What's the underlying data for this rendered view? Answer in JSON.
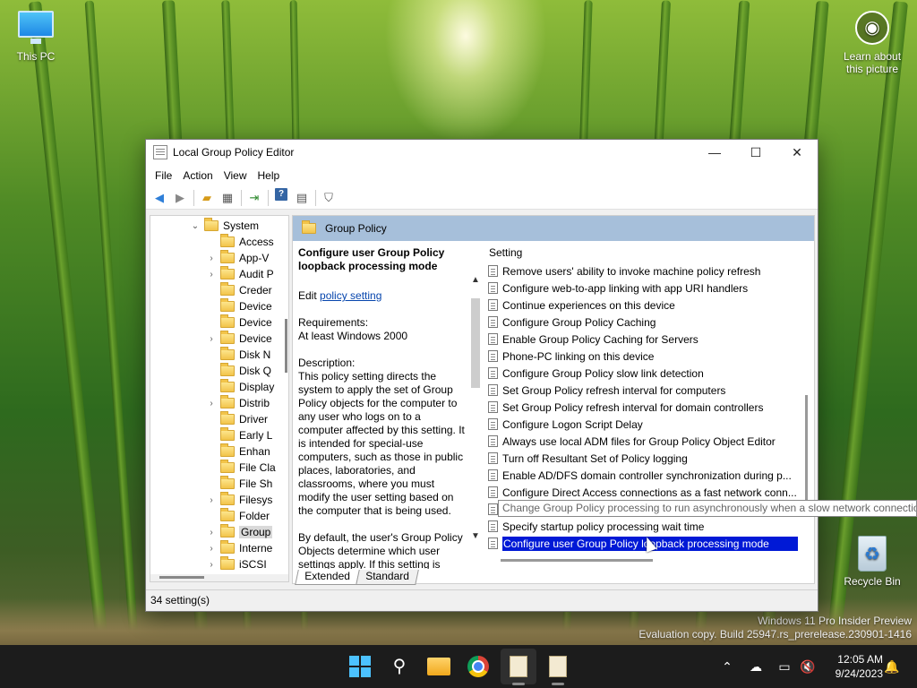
{
  "desktop": {
    "icons": {
      "this_pc": "This PC",
      "recycle_bin": "Recycle Bin",
      "learn_line1": "Learn about",
      "learn_line2": "this picture"
    },
    "watermark": {
      "line1": "Windows 11 Pro Insider Preview",
      "line2": "Evaluation copy. Build 25947.rs_prerelease.230901-1416"
    }
  },
  "window": {
    "title": "Local Group Policy Editor",
    "controls": {
      "minimize": "—",
      "maximize": "☐",
      "close": "✕"
    },
    "menu": [
      "File",
      "Action",
      "View",
      "Help"
    ],
    "tree": {
      "root": "System",
      "items": [
        {
          "label": "Access",
          "expander": ""
        },
        {
          "label": "App-V",
          "expander": "›"
        },
        {
          "label": "Audit P",
          "expander": "›"
        },
        {
          "label": "Creder",
          "expander": ""
        },
        {
          "label": "Device",
          "expander": ""
        },
        {
          "label": "Device",
          "expander": ""
        },
        {
          "label": "Device",
          "expander": "›"
        },
        {
          "label": "Disk N",
          "expander": ""
        },
        {
          "label": "Disk Q",
          "expander": ""
        },
        {
          "label": "Display",
          "expander": ""
        },
        {
          "label": "Distrib",
          "expander": "›"
        },
        {
          "label": "Driver",
          "expander": ""
        },
        {
          "label": "Early L",
          "expander": ""
        },
        {
          "label": "Enhan",
          "expander": ""
        },
        {
          "label": "File Cla",
          "expander": ""
        },
        {
          "label": "File Sh",
          "expander": ""
        },
        {
          "label": "Filesys",
          "expander": "›"
        },
        {
          "label": "Folder",
          "expander": ""
        },
        {
          "label": "Group",
          "expander": "›",
          "selected": true
        },
        {
          "label": "Interne",
          "expander": "›"
        },
        {
          "label": "iSCSI",
          "expander": "›"
        }
      ]
    },
    "right_header": "Group Policy",
    "description": {
      "title": "Configure user Group Policy loopback processing mode",
      "edit_prefix": "Edit ",
      "edit_link": "policy setting",
      "requirements_label": "Requirements:",
      "requirements_value": "At least Windows 2000",
      "description_label": "Description:",
      "body1": "This policy setting directs the system to apply the set of Group Policy objects for the computer to any user who logs on to a computer affected by this setting. It is intended for special-use computers, such as those in public places, laboratories, and classrooms, where you must modify the user setting based on the computer that is being used.",
      "body2": "By default, the user's Group Policy Objects determine which user settings apply. If this setting is"
    },
    "list": {
      "column": "Setting",
      "rows": [
        "Remove users' ability to invoke machine policy refresh",
        "Configure web-to-app linking with app URI handlers",
        "Continue experiences on this device",
        "Configure Group Policy Caching",
        "Enable Group Policy Caching for Servers",
        "Phone-PC linking on this device",
        "Configure Group Policy slow link detection",
        "Set Group Policy refresh interval for computers",
        "Set Group Policy refresh interval for domain controllers",
        "Configure Logon Script Delay",
        "Always use local ADM files for Group Policy Object Editor",
        "Turn off Resultant Set of Policy logging",
        "Enable AD/DFS domain controller synchronization during p...",
        "Configure Direct Access connections as a fast network conn...",
        "Change Group Policy processing to run asynchronously whe...",
        "Specify startup policy processing wait time",
        "Configure user Group Policy loopback processing mode"
      ],
      "selected_index": 16,
      "tooltip_index": 14
    },
    "tooltip": "Change Group Policy processing to run asynchronously when a slow network connection",
    "tabs": [
      "Extended",
      "Standard"
    ],
    "status": "34 setting(s)"
  },
  "taskbar": {
    "time": "12:05 AM",
    "date": "9/24/2023"
  }
}
